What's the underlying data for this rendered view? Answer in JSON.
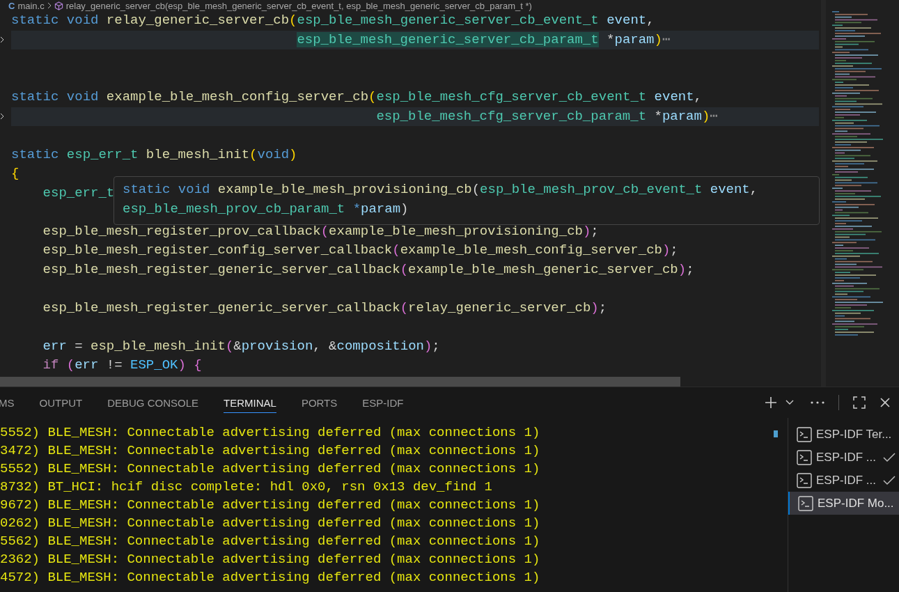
{
  "breadcrumb": {
    "file_icon": "C",
    "file": "main.c",
    "symbol": "relay_generic_server_cb(esp_ble_mesh_generic_server_cb_event_t, esp_ble_mesh_generic_server_cb_param_t *)"
  },
  "code_lines": [
    {
      "kind": "top",
      "folded": false,
      "tokens": [
        {
          "text": "static ",
          "kind": "kw"
        },
        {
          "text": "void ",
          "kind": "kw"
        },
        {
          "text": "relay_generic_server_cb",
          "kind": "fn"
        },
        {
          "text": "(",
          "kind": "br"
        },
        {
          "text": "esp_ble_mesh_generic_server_cb_event_t ",
          "kind": "type"
        },
        {
          "text": "event",
          "kind": "param"
        },
        {
          "text": ",",
          "kind": "plain"
        }
      ]
    },
    {
      "kind": "continuation",
      "folded": true,
      "tokens": [
        {
          "text": "esp_ble_mesh_generic_server_cb_param_t",
          "kind": "type",
          "highlighted": true
        },
        {
          "text": " *",
          "kind": "plain"
        },
        {
          "text": "param",
          "kind": "param"
        },
        {
          "text": ")",
          "kind": "br"
        },
        {
          "text": "⋯",
          "kind": "fold"
        }
      ]
    },
    {
      "kind": "blank"
    },
    {
      "kind": "blank"
    },
    {
      "kind": "top",
      "folded": false,
      "tokens": [
        {
          "text": "static ",
          "kind": "kw"
        },
        {
          "text": "void ",
          "kind": "kw"
        },
        {
          "text": "example_ble_mesh_config_server_cb",
          "kind": "fn"
        },
        {
          "text": "(",
          "kind": "br"
        },
        {
          "text": "esp_ble_mesh_cfg_server_cb_event_t ",
          "kind": "type"
        },
        {
          "text": "event",
          "kind": "param"
        },
        {
          "text": ",",
          "kind": "plain"
        }
      ]
    },
    {
      "kind": "continuation",
      "folded": true,
      "tokens": [
        {
          "text": "esp_ble_mesh_cfg_server_cb_param_t",
          "kind": "type",
          "highlighted": false
        },
        {
          "text": " *",
          "kind": "plain"
        },
        {
          "text": "param",
          "kind": "param"
        },
        {
          "text": ")",
          "kind": "br"
        },
        {
          "text": "⋯",
          "kind": "fold"
        }
      ]
    },
    {
      "kind": "blank"
    },
    {
      "kind": "top",
      "folded": false,
      "tokens": [
        {
          "text": "static ",
          "kind": "kw"
        },
        {
          "text": "esp_err_t ",
          "kind": "type"
        },
        {
          "text": "ble_mesh_init",
          "kind": "fn"
        },
        {
          "text": "(",
          "kind": "br"
        },
        {
          "text": "void",
          "kind": "kw"
        },
        {
          "text": ")",
          "kind": "br"
        }
      ]
    },
    {
      "kind": "top",
      "folded": false,
      "tokens": [
        {
          "text": "{",
          "kind": "br"
        }
      ]
    },
    {
      "kind": "body",
      "folded": false,
      "tokens": [
        {
          "text": "esp_err_t",
          "kind": "type"
        }
      ]
    },
    {
      "kind": "blank"
    },
    {
      "kind": "body",
      "folded": false,
      "tokens": [
        {
          "text": "esp_ble_mesh_register_prov_callback",
          "kind": "fn"
        },
        {
          "text": "(",
          "kind": "br2"
        },
        {
          "text": "example_ble_mesh_provisioning_cb",
          "kind": "fn"
        },
        {
          "text": ")",
          "kind": "br2"
        },
        {
          "text": ";",
          "kind": "plain"
        }
      ]
    },
    {
      "kind": "body",
      "folded": false,
      "tokens": [
        {
          "text": "esp_ble_mesh_register_config_server_callback",
          "kind": "fn"
        },
        {
          "text": "(",
          "kind": "br2"
        },
        {
          "text": "example_ble_mesh_config_server_cb",
          "kind": "fn"
        },
        {
          "text": ")",
          "kind": "br2"
        },
        {
          "text": ";",
          "kind": "plain"
        }
      ]
    },
    {
      "kind": "body",
      "folded": false,
      "tokens": [
        {
          "text": "esp_ble_mesh_register_generic_server_callback",
          "kind": "fn"
        },
        {
          "text": "(",
          "kind": "br2"
        },
        {
          "text": "example_ble_mesh_generic_server_cb",
          "kind": "fn"
        },
        {
          "text": ")",
          "kind": "br2"
        },
        {
          "text": ";",
          "kind": "plain"
        }
      ]
    },
    {
      "kind": "blank"
    },
    {
      "kind": "body",
      "folded": false,
      "tokens": [
        {
          "text": "esp_ble_mesh_register_generic_server_callback",
          "kind": "fn"
        },
        {
          "text": "(",
          "kind": "br2"
        },
        {
          "text": "relay_generic_server_cb",
          "kind": "fn"
        },
        {
          "text": ")",
          "kind": "br2"
        },
        {
          "text": ";",
          "kind": "plain"
        }
      ]
    },
    {
      "kind": "blank"
    },
    {
      "kind": "body",
      "folded": false,
      "tokens": [
        {
          "text": "err",
          "kind": "param"
        },
        {
          "text": " = ",
          "kind": "plain"
        },
        {
          "text": "esp_ble_mesh_init",
          "kind": "fn"
        },
        {
          "text": "(",
          "kind": "br2"
        },
        {
          "text": "&",
          "kind": "plain"
        },
        {
          "text": "provision",
          "kind": "param"
        },
        {
          "text": ", &",
          "kind": "plain"
        },
        {
          "text": "composition",
          "kind": "param"
        },
        {
          "text": ")",
          "kind": "br2"
        },
        {
          "text": ";",
          "kind": "plain"
        }
      ]
    },
    {
      "kind": "body",
      "folded": false,
      "tokens": [
        {
          "text": "if ",
          "kind": "ctrl"
        },
        {
          "text": "(",
          "kind": "br2"
        },
        {
          "text": "err",
          "kind": "param"
        },
        {
          "text": " != ",
          "kind": "plain"
        },
        {
          "text": "ESP_OK",
          "kind": "const"
        },
        {
          "text": ") ",
          "kind": "br2"
        },
        {
          "text": "{",
          "kind": "br2"
        }
      ]
    }
  ],
  "hover": {
    "lines": [
      [
        {
          "text": "static ",
          "kind": "kw"
        },
        {
          "text": "void ",
          "kind": "kw"
        },
        {
          "text": "example_ble_mesh_provisioning_cb",
          "kind": "fn"
        },
        {
          "text": "(",
          "kind": "plain"
        },
        {
          "text": "esp_ble_mesh_prov_cb_event_t ",
          "kind": "type"
        },
        {
          "text": "event",
          "kind": "param"
        },
        {
          "text": ",",
          "kind": "plain"
        }
      ],
      [
        {
          "text": "esp_ble_mesh_prov_cb_param_t ",
          "kind": "type"
        },
        {
          "text": "*",
          "kind": "kw"
        },
        {
          "text": "param",
          "kind": "param"
        },
        {
          "text": ")",
          "kind": "plain"
        }
      ]
    ]
  },
  "panel": {
    "tabs": [
      {
        "label": "MS",
        "selected": false
      },
      {
        "label": "OUTPUT",
        "selected": false
      },
      {
        "label": "DEBUG CONSOLE",
        "selected": false
      },
      {
        "label": "TERMINAL",
        "selected": true
      },
      {
        "label": "PORTS",
        "selected": false
      },
      {
        "label": "ESP-IDF",
        "selected": false
      }
    ],
    "terminal_lines": [
      "5552) BLE_MESH: Connectable advertising deferred (max connections 1)",
      "3472) BLE_MESH: Connectable advertising deferred (max connections 1)",
      "5552) BLE_MESH: Connectable advertising deferred (max connections 1)",
      "8732) BT_HCI: hcif disc complete: hdl 0x0, rsn 0x13 dev_find 1",
      "9672) BLE_MESH: Connectable advertising deferred (max connections 1)",
      "0262) BLE_MESH: Connectable advertising deferred (max connections 1)",
      "5562) BLE_MESH: Connectable advertising deferred (max connections 1)",
      "2362) BLE_MESH: Connectable advertising deferred (max connections 1)",
      "4572) BLE_MESH: Connectable advertising deferred (max connections 1)"
    ],
    "terminals": [
      {
        "label": "ESP-IDF Ter...",
        "done": false,
        "selected": false
      },
      {
        "label": "ESP-IDF ...",
        "done": true,
        "selected": false
      },
      {
        "label": "ESP-IDF ...",
        "done": true,
        "selected": false
      },
      {
        "label": "ESP-IDF Mo...",
        "done": false,
        "selected": true
      }
    ]
  }
}
